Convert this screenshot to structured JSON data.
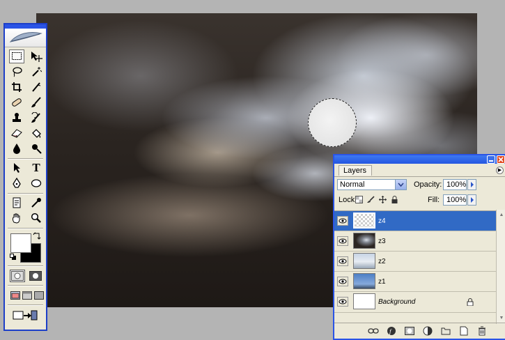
{
  "canvas": {
    "description_icon": "cloudy-moon-sky-image"
  },
  "toolbox": {
    "tools": [
      {
        "name": "rectangular-marquee-tool-icon"
      },
      {
        "name": "move-tool-icon"
      },
      {
        "name": "lasso-tool-icon"
      },
      {
        "name": "magic-wand-tool-icon"
      },
      {
        "name": "crop-tool-icon"
      },
      {
        "name": "slice-tool-icon"
      },
      {
        "name": "healing-brush-tool-icon"
      },
      {
        "name": "brush-tool-icon"
      },
      {
        "name": "clone-stamp-tool-icon"
      },
      {
        "name": "history-brush-tool-icon"
      },
      {
        "name": "eraser-tool-icon"
      },
      {
        "name": "paint-bucket-tool-icon"
      },
      {
        "name": "blur-tool-icon"
      },
      {
        "name": "dodge-tool-icon"
      },
      {
        "name": "path-selection-tool-icon"
      },
      {
        "name": "type-tool-icon"
      },
      {
        "name": "pen-tool-icon"
      },
      {
        "name": "ellipse-tool-icon"
      },
      {
        "name": "notes-tool-icon"
      },
      {
        "name": "eyedropper-tool-icon"
      },
      {
        "name": "hand-tool-icon"
      },
      {
        "name": "zoom-tool-icon"
      }
    ],
    "type_tool_glyph": "T",
    "foreground_color": "#ffffff",
    "background_color": "#000000"
  },
  "layers_panel": {
    "tab_label": "Layers",
    "blend_mode": "Normal",
    "opacity_label": "Opacity:",
    "opacity_value": "100%",
    "lock_label": "Lock:",
    "fill_label": "Fill:",
    "fill_value": "100%",
    "selected_color": "#316ac5",
    "layers": [
      {
        "name": "z4",
        "thumb": "transparent",
        "selected": true
      },
      {
        "name": "z3",
        "thumb": "dark-sky"
      },
      {
        "name": "z2",
        "thumb": "light-sky"
      },
      {
        "name": "z1",
        "thumb": "blue-sky"
      },
      {
        "name": "Background",
        "thumb": "white",
        "locked": true
      }
    ]
  }
}
